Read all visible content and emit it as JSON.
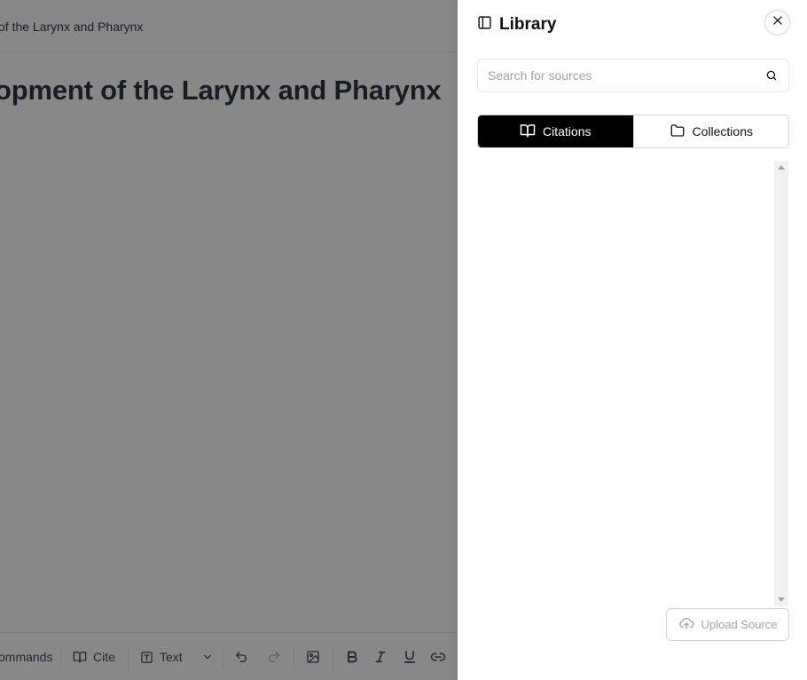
{
  "editor": {
    "breadcrumb": "of the Larynx and Pharynx",
    "title": "opment of the Larynx and Pharynx",
    "toolbar": {
      "commands_label": "ommands",
      "cite_label": "Cite",
      "text_label": "Text"
    }
  },
  "library": {
    "title": "Library",
    "search_placeholder": "Search for sources",
    "tabs": [
      {
        "label": "Citations",
        "active": true
      },
      {
        "label": "Collections",
        "active": false
      }
    ],
    "upload_label": "Upload Source"
  },
  "icons": {
    "panel": "panel-icon",
    "close": "close-icon",
    "search": "search-icon",
    "citations": "book-open-icon",
    "collections": "folder-icon",
    "upload": "cloud-upload-icon"
  },
  "colors": {
    "active_tab_bg": "#000000",
    "overlay": "#111111",
    "text_dark": "#1f2937",
    "muted": "#9ca3af"
  }
}
